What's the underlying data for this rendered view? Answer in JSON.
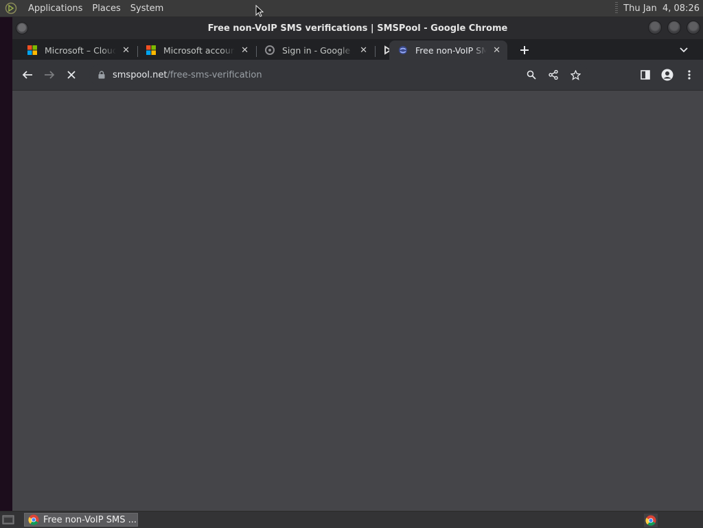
{
  "top_panel": {
    "menu": [
      "Applications",
      "Places",
      "System"
    ],
    "clock": "Thu Jan  4, 08:26"
  },
  "window": {
    "title": "Free non-VoIP SMS verifications | SMSPool - Google Chrome"
  },
  "tabs": [
    {
      "title": "Microsoft – Cloud, Computers, Apps & Gaming",
      "icon": "microsoft-icon",
      "active": false
    },
    {
      "title": "Microsoft account",
      "icon": "microsoft-icon",
      "active": false
    },
    {
      "title": "Sign in - Google Accounts",
      "icon": "google-icon",
      "active": false
    },
    {
      "title": "",
      "icon": "pinned-tab-icon",
      "active": false
    },
    {
      "title": "Free non-VoIP SMS verifications",
      "icon": "smspool-icon",
      "active": true
    }
  ],
  "toolbar": {
    "url_host": "smspool.net",
    "url_path": "/free-sms-verification"
  },
  "taskbar": {
    "task_label": "Free non-VoIP SMS ..."
  },
  "colors": {
    "content_bg": "#454549",
    "tabstrip_bg": "#202124",
    "toolbar_bg": "#35363a"
  }
}
